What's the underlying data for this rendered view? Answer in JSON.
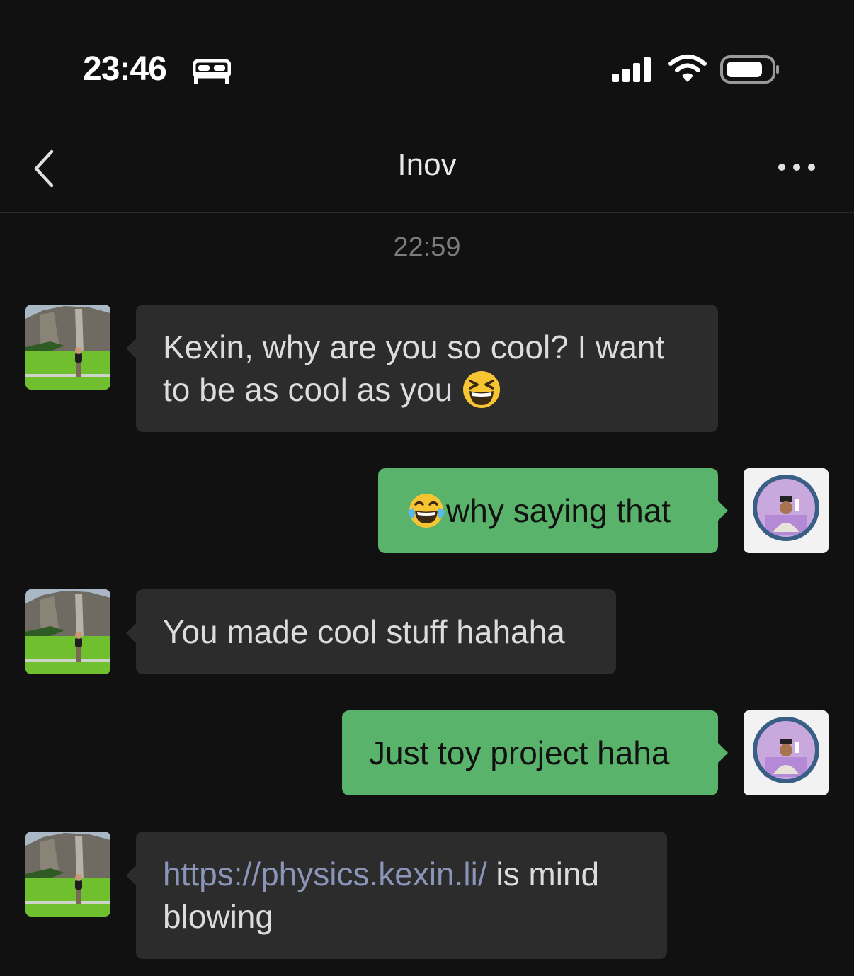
{
  "status_bar": {
    "time": "23:46",
    "sleep_mode_icon": "bed-icon",
    "signal_icon": "cellular-signal-icon",
    "wifi_icon": "wifi-icon",
    "battery_icon": "battery-icon"
  },
  "nav": {
    "back_icon": "chevron-left-icon",
    "title": "Inov",
    "more_icon": "more-dots-icon"
  },
  "chat": {
    "timestamp": "22:59",
    "messages": [
      {
        "direction": "incoming",
        "text_before": "Kexin, why are you so cool? I want to be as cool as you ",
        "emoji": "grinning-squinting-face-icon"
      },
      {
        "direction": "outgoing",
        "emoji": "face-with-tears-of-joy-icon",
        "text": "why saying that"
      },
      {
        "direction": "incoming",
        "text": "You made cool stuff hahaha"
      },
      {
        "direction": "outgoing",
        "text": "Just toy project haha"
      },
      {
        "direction": "incoming",
        "link": "https://physics.kexin.li/",
        "text_after": " is mind blowing"
      }
    ]
  },
  "colors": {
    "background": "#111111",
    "incoming_bubble": "#2c2c2c",
    "outgoing_bubble": "#59b36a",
    "link": "#8a95b8",
    "timestamp": "#7c7c7c"
  }
}
